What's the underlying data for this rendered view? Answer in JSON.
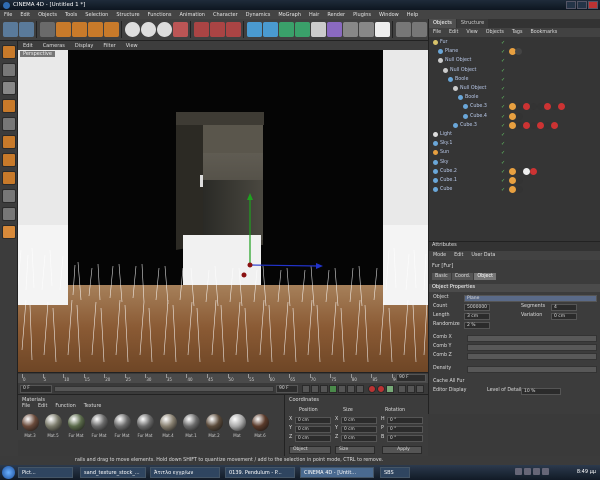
{
  "window": {
    "title": "CINEMA 4D - [Untitled 1 *]"
  },
  "menubar": [
    "File",
    "Edit",
    "Objects",
    "Tools",
    "Selection",
    "Structure",
    "Functions",
    "Animation",
    "Character",
    "Dynamics",
    "MoGraph",
    "Hair",
    "Render",
    "Plugins",
    "Window",
    "Help"
  ],
  "viewport": {
    "menu": [
      "Edit",
      "Cameras",
      "Display",
      "Filter",
      "View"
    ],
    "camera_label": "Perspective"
  },
  "timeline": {
    "ticks": [
      "0",
      "5",
      "10",
      "15",
      "20",
      "25",
      "30",
      "35",
      "40",
      "45",
      "50",
      "55",
      "60",
      "65",
      "70",
      "75",
      "80",
      "85",
      "90"
    ],
    "current_frame": "0 F",
    "start_field": "0 F",
    "end_field": "90 F",
    "end_label": "90 F"
  },
  "object_manager": {
    "tabs": [
      "Objects",
      "Structure"
    ],
    "menu": [
      "File",
      "Edit",
      "View",
      "Objects",
      "Tags",
      "Bookmarks"
    ],
    "objects": [
      {
        "name": "Fur",
        "indent": 0,
        "color": "#d9c36a"
      },
      {
        "name": "Plane",
        "indent": 1,
        "color": "#6aa7d9"
      },
      {
        "name": "Null Object",
        "indent": 1,
        "color": "#cccccc"
      },
      {
        "name": "Null Object",
        "indent": 2,
        "color": "#cccccc"
      },
      {
        "name": "Boole",
        "indent": 3,
        "color": "#6aa7d9"
      },
      {
        "name": "Null Object",
        "indent": 4,
        "color": "#cccccc"
      },
      {
        "name": "Boole",
        "indent": 5,
        "color": "#6aa7d9"
      },
      {
        "name": "Cube.3",
        "indent": 6,
        "color": "#6aa7d9"
      },
      {
        "name": "Cube.4",
        "indent": 6,
        "color": "#6aa7d9"
      },
      {
        "name": "Cube.3",
        "indent": 4,
        "color": "#6aa7d9"
      },
      {
        "name": "Light",
        "indent": 0,
        "color": "#dddddd"
      },
      {
        "name": "Sky.1",
        "indent": 0,
        "color": "#6aa7d9"
      },
      {
        "name": "Sun",
        "indent": 0,
        "color": "#e8a040"
      },
      {
        "name": "Sky",
        "indent": 0,
        "color": "#6aa7d9"
      },
      {
        "name": "Cube.2",
        "indent": 0,
        "color": "#6aa7d9"
      },
      {
        "name": "Cube.1",
        "indent": 0,
        "color": "#6aa7d9"
      },
      {
        "name": "Cube",
        "indent": 0,
        "color": "#6aa7d9"
      }
    ]
  },
  "attributes": {
    "title": "Attributes",
    "menu": [
      "Mode",
      "Edit",
      "User Data"
    ],
    "object_name": "Fur [Fur]",
    "tabs": [
      "Basic",
      "Coord.",
      "Object"
    ],
    "section": "Object Properties",
    "fields": {
      "object_label": "Object",
      "object_value": "Plane",
      "count_label": "Count",
      "count_value": "5000000",
      "segments_label": "Segments",
      "segments_value": "4",
      "length_label": "Length",
      "length_value": "3 cm",
      "variation_label": "Variation",
      "variation_value": "0 cm",
      "randomize_label": "Randomize",
      "randomize_value": "2 %",
      "combx_label": "Comb X",
      "comby_label": "Comb Y",
      "combz_label": "Comb Z",
      "density_label": "Density",
      "cache_label": "Cache All Fur",
      "editor_label": "Editor Display",
      "lod_label": "Level of Detail",
      "lod_value": "10 %"
    }
  },
  "materials": {
    "title": "Materials",
    "menu": [
      "File",
      "Edit",
      "Function",
      "Texture"
    ],
    "items": [
      {
        "label": "Mat.3",
        "color": "#6a4a3a"
      },
      {
        "label": "Mat.5",
        "color": "#7a7a6a"
      },
      {
        "label": "Fur Mat",
        "color": "#5a6a4a"
      },
      {
        "label": "Fur Mat",
        "color": "#6a6a6a"
      },
      {
        "label": "Fur Mat",
        "color": "#6a6a6a"
      },
      {
        "label": "Fur Mat",
        "color": "#6a6a6a"
      },
      {
        "label": "Mat.4",
        "color": "#888070"
      },
      {
        "label": "Mat.1",
        "color": "#6a6a6a"
      },
      {
        "label": "Mat.2",
        "color": "#5a4a3a"
      },
      {
        "label": "Mat",
        "color": "#aaaaaa"
      },
      {
        "label": "Mat.6",
        "color": "#5a3a2a"
      }
    ]
  },
  "coordinates": {
    "title": "Coordinates",
    "headers": [
      "Position",
      "Size",
      "Rotation"
    ],
    "rows": [
      {
        "axis": "X",
        "pos": "0 cm",
        "size_axis": "X",
        "size": "0 cm",
        "rot_axis": "H",
        "rot": "0 °"
      },
      {
        "axis": "Y",
        "pos": "0 cm",
        "size_axis": "Y",
        "size": "0 cm",
        "rot_axis": "P",
        "rot": "0 °"
      },
      {
        "axis": "Z",
        "pos": "0 cm",
        "size_axis": "Z",
        "size": "0 cm",
        "rot_axis": "B",
        "rot": "0 °"
      }
    ],
    "mode1": "Object",
    "mode2": "Size",
    "apply": "Apply"
  },
  "status": "rails and drag to move elements. Hold down SHIFT to quantize movement / add to the selection in point mode, CTRL to remove.",
  "taskbar": {
    "items": [
      "Pict...",
      "sand_texture_stock_...",
      "Άτιτλο εγγρ/ων",
      "0139. Pendulum - P...",
      "CINEMA 4D - [Untit...",
      "SBS"
    ],
    "clock": "8:49 μμ",
    "lang": "EN"
  }
}
